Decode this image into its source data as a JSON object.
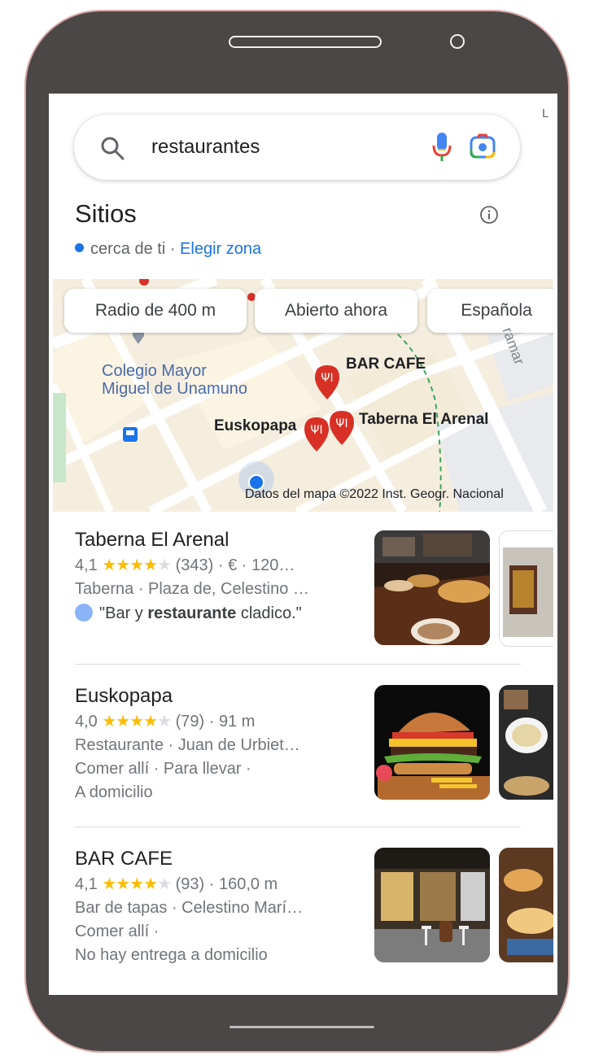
{
  "search": {
    "query": "restaurantes",
    "right_peek": "L"
  },
  "section": {
    "title": "Sitios",
    "near_text": "cerca de ti ·",
    "zone_link": "Elegir zona"
  },
  "filters": [
    "Radio de 400 m",
    "Abierto ahora",
    "Española"
  ],
  "map": {
    "labels": {
      "college": "Colegio Mayor\nMiguel de Unamuno",
      "bar_cafe": "BAR CAFE",
      "euskopapa": "Euskopapa",
      "taberna": "Taberna El Arenal",
      "street": "ramar"
    },
    "attribution": "Datos del mapa ©2022 Inst. Geogr. Nacional"
  },
  "results": [
    {
      "name": "Taberna El Arenal",
      "rating": "4,1",
      "stars": 4.1,
      "reviews": "(343)",
      "meta": "· € · 120…",
      "line2": "Taberna · Plaza de, Celestino …",
      "review_pre": "\"Bar y ",
      "review_bold": "restaurante",
      "review_post": " cladico.\""
    },
    {
      "name": "Euskopapa",
      "rating": "4,0",
      "stars": 4.0,
      "reviews": "(79)",
      "meta": "· 91 m",
      "line2": "Restaurante · Juan de Urbiet…",
      "line3": "Comer allí · Para llevar ·",
      "line4": "A domicilio"
    },
    {
      "name": "BAR CAFE",
      "rating": "4,1",
      "stars": 4.1,
      "reviews": "(93)",
      "meta": "· 160,0 m",
      "line2": "Bar de tapas · Celestino Marí…",
      "line3": "Comer allí ·",
      "line4": "No hay entrega a domicilio"
    }
  ],
  "colors": {
    "accent": "#1a73e8",
    "star": "#fbbc04",
    "pin": "#d93025"
  }
}
